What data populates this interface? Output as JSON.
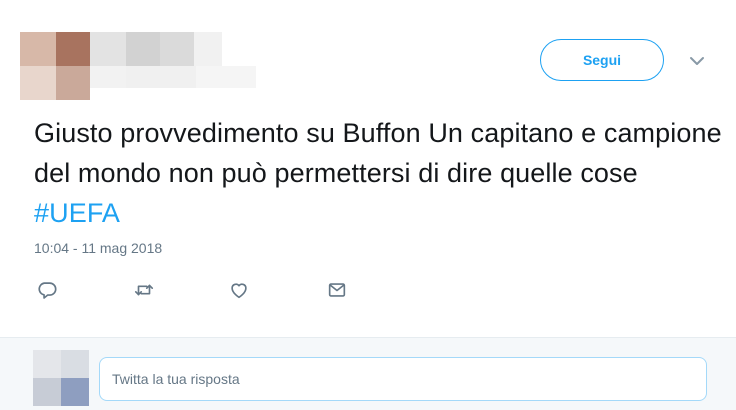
{
  "tweet": {
    "author_obscured": true,
    "follow_label": "Segui",
    "more_icon": "chevron-down-icon",
    "text_main": "Giusto provvedimento su Buffon Un capitano e campione del mondo non può permettersi di dire quelle cose ",
    "hashtag": "#UEFA",
    "timestamp": "10:04 - 11 mag 2018",
    "actions": [
      "reply-icon",
      "retweet-icon",
      "like-icon",
      "direct-message-icon"
    ]
  },
  "reply": {
    "placeholder": "Twitta la tua risposta"
  },
  "colors": {
    "accent": "#1da1f2",
    "text": "#14171a",
    "muted": "#657786",
    "reply_bg": "#f5f8fa"
  }
}
